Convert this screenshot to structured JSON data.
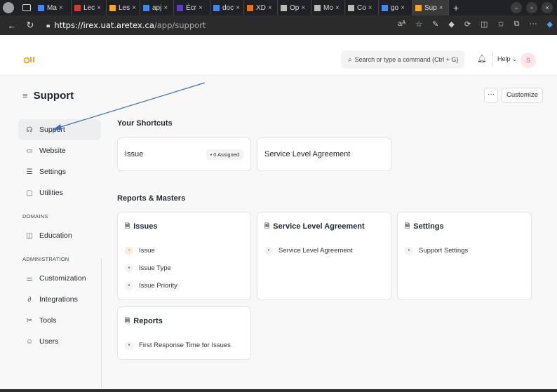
{
  "browser": {
    "tabs": [
      {
        "label": "Ma",
        "color": "#4285f4"
      },
      {
        "label": "Lec",
        "color": "#d63b2f"
      },
      {
        "label": "Les",
        "color": "#f5a623"
      },
      {
        "label": "apj",
        "color": "#4285f4"
      },
      {
        "label": "Écr",
        "color": "#5b3cc4"
      },
      {
        "label": "doc",
        "color": "#4285f4"
      },
      {
        "label": "XD",
        "color": "#e8710a"
      },
      {
        "label": "Op",
        "color": "#bbbbbb"
      },
      {
        "label": "Mo",
        "color": "#bbbbbb"
      },
      {
        "label": "Co",
        "color": "#bbbbbb"
      },
      {
        "label": "go",
        "color": "#4285f4"
      },
      {
        "label": "Sup",
        "color": "#f5a623"
      }
    ],
    "url_host": "https://irex.uat.aretex.ca",
    "url_path": "/app/support"
  },
  "topnav": {
    "search_placeholder": "Search or type a command (Ctrl + G)",
    "help_label": "Help ⌄",
    "avatar_initial": "S"
  },
  "page": {
    "title": "Support",
    "more_label": "···",
    "customize_label": "Customize"
  },
  "sidebar": {
    "items": [
      {
        "label": "Support",
        "icon": "headset-icon"
      },
      {
        "label": "Website",
        "icon": "browser-icon"
      },
      {
        "label": "Settings",
        "icon": "settings-icon"
      },
      {
        "label": "Utilities",
        "icon": "folder-icon"
      }
    ],
    "domains_heading": "DOMAINS",
    "domains": [
      {
        "label": "Education",
        "icon": "book-icon"
      }
    ],
    "admin_heading": "ADMINISTRATION",
    "admin": [
      {
        "label": "Customization",
        "icon": "sliders-icon"
      },
      {
        "label": "Integrations",
        "icon": "integration-icon"
      },
      {
        "label": "Tools",
        "icon": "tools-icon"
      },
      {
        "label": "Users",
        "icon": "users-icon"
      }
    ]
  },
  "shortcuts": {
    "heading": "Your Shortcuts",
    "items": [
      {
        "label": "Issue",
        "badge": "• 0 Assigned"
      },
      {
        "label": "Service Level Agreement"
      }
    ]
  },
  "reports": {
    "heading": "Reports & Masters",
    "cards": [
      {
        "title": "Issues",
        "links": [
          "Issue",
          "Issue Type",
          "Issue Priority"
        ]
      },
      {
        "title": "Service Level Agreement",
        "links": [
          "Service Level Agreement"
        ]
      },
      {
        "title": "Settings",
        "links": [
          "Support Settings"
        ]
      },
      {
        "title": "Reports",
        "links": [
          "First Response Time for Issues"
        ]
      }
    ]
  },
  "annotation": {
    "arrow_color": "#3a6fb5"
  }
}
